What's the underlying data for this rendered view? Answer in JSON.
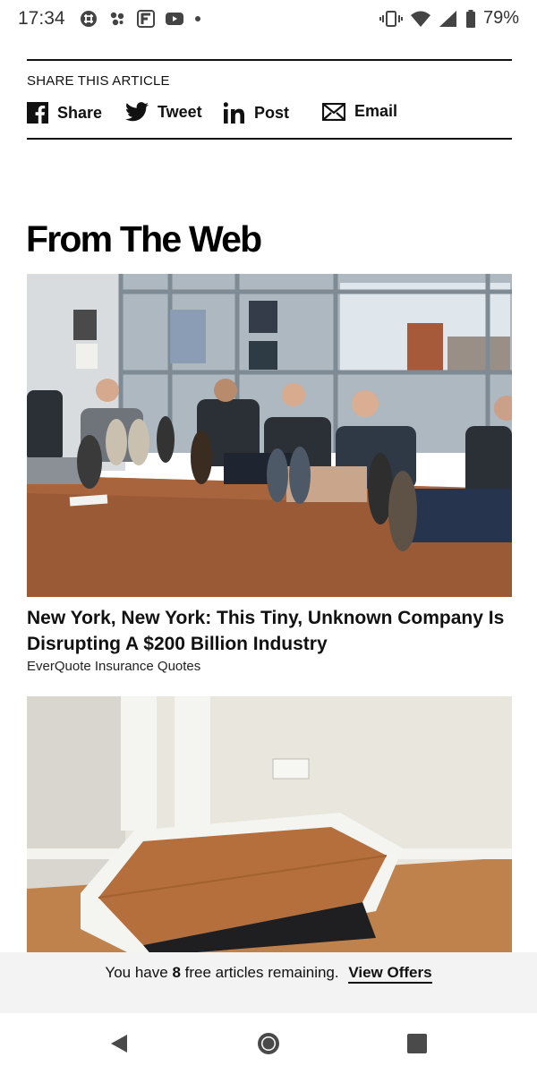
{
  "status_bar": {
    "time": "17:34",
    "battery_percent": "79%",
    "left_icons": [
      "slack-icon",
      "pinwheel-icon",
      "flipboard-icon",
      "youtube-icon",
      "dot-icon"
    ],
    "right_icons": [
      "vibrate-icon",
      "wifi-icon",
      "signal-icon",
      "battery-icon"
    ]
  },
  "share": {
    "title": "SHARE THIS ARTICLE",
    "items": [
      {
        "icon": "facebook-icon",
        "label": "Share"
      },
      {
        "icon": "twitter-icon",
        "label": "Tweet"
      },
      {
        "icon": "linkedin-icon",
        "label": "Post"
      },
      {
        "icon": "email-icon",
        "label": "Email"
      }
    ]
  },
  "section": {
    "title": "From The Web"
  },
  "articles": [
    {
      "title": "New York, New York: This Tiny, Unknown Company Is Disrupting A $200 Billion Industry",
      "source": "EverQuote Insurance Quotes"
    }
  ],
  "banner": {
    "prefix": "You have",
    "count": "8",
    "suffix": "free articles remaining.",
    "cta": "View Offers"
  },
  "nav": [
    "back-icon",
    "home-icon",
    "recents-icon"
  ],
  "colors": {
    "text": "#111111",
    "banner_bg": "#f3f3f3"
  }
}
